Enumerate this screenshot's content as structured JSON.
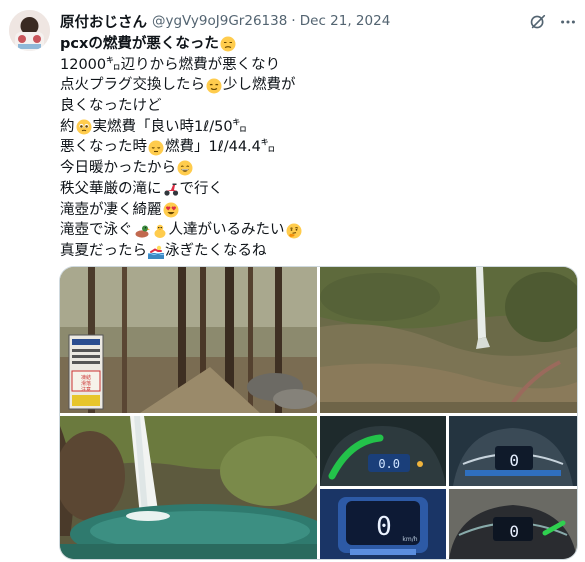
{
  "author": {
    "display_name": "原付おじさん",
    "handle": "@ygVy9oJ9Gr26138",
    "separator": "·",
    "date": "Dec 21, 2024"
  },
  "post": {
    "lines": [
      {
        "type": "title",
        "segments": [
          {
            "t": "pcxの燃費が悪くなった"
          },
          {
            "emoji": "disappointed-face"
          }
        ]
      },
      {
        "segments": [
          {
            "t": "12000㌔辺りから燃費が悪くなり"
          }
        ]
      },
      {
        "segments": [
          {
            "t": "点火プラグ交換したら"
          },
          {
            "emoji": "relieved-face"
          },
          {
            "t": "少し燃費が"
          }
        ]
      },
      {
        "segments": [
          {
            "t": "良くなったけど"
          }
        ]
      },
      {
        "segments": [
          {
            "t": "約"
          },
          {
            "emoji": "pleading-face"
          },
          {
            "t": "実燃費「良い時1ℓ/50㌔"
          }
        ]
      },
      {
        "segments": [
          {
            "t": "悪くなった時"
          },
          {
            "emoji": "pensive-face"
          },
          {
            "t": "燃費」1ℓ/44.4㌔"
          }
        ]
      },
      {
        "segments": [
          {
            "t": "今日暖かったから"
          },
          {
            "emoji": "grinning-face"
          }
        ]
      },
      {
        "segments": [
          {
            "t": "秩父華厳の滝に"
          },
          {
            "emoji": "scooter"
          },
          {
            "t": "で行く"
          }
        ]
      },
      {
        "segments": [
          {
            "t": "滝壺が凄く綺麗"
          },
          {
            "emoji": "heart-eyes-face"
          }
        ]
      },
      {
        "segments": [
          {
            "t": "滝壺で泳ぐ"
          },
          {
            "emoji": "duck"
          },
          {
            "emoji": "baby-chick"
          },
          {
            "t": "人達がいるみたい"
          },
          {
            "emoji": "thinking-face"
          }
        ]
      },
      {
        "segments": [
          {
            "t": "真夏だったら"
          },
          {
            "emoji": "person-swimming"
          },
          {
            "t": "泳ぎたくなるね"
          }
        ]
      }
    ]
  },
  "media": {
    "photos": [
      {
        "name": "forest-trail-sign-photo",
        "sign_lines": [
          "凍結",
          "滑落",
          "注意"
        ]
      },
      {
        "name": "mountain-waterfall-photo"
      },
      {
        "name": "waterfall-pool-photo"
      },
      {
        "name": "dashboard-green-photo",
        "readout": "0.0"
      },
      {
        "name": "dashboard-blue-photo",
        "readout": "0"
      },
      {
        "name": "dashboard-speedometer-photo",
        "readout": "0",
        "unit": "km/h"
      },
      {
        "name": "dashboard-night-photo",
        "readout": "0"
      }
    ]
  },
  "icons": {
    "grok": "grok-icon",
    "more": "more-options-icon"
  },
  "colors": {
    "text_primary": "#0f1419",
    "text_secondary": "#536471",
    "border": "#cfd9de"
  }
}
